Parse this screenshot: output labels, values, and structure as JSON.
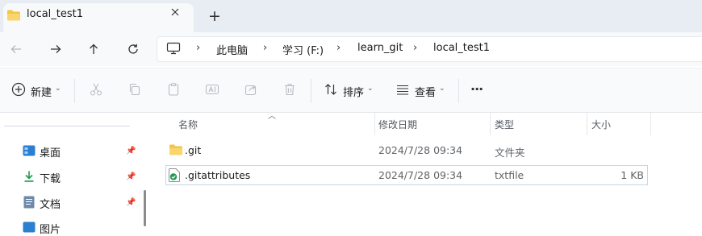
{
  "window": {
    "tab_title": "local_test1",
    "new_tab_label": "+"
  },
  "address": {
    "crumbs": [
      "此电脑",
      "学习 (F:)",
      "learn_git",
      "local_test1"
    ]
  },
  "toolbar": {
    "new_label": "新建",
    "sort_label": "排序",
    "view_label": "查看",
    "more_label": "···"
  },
  "sidebar": {
    "items": [
      {
        "label": "桌面",
        "icon": "desktop-icon",
        "pinned": true
      },
      {
        "label": "下载",
        "icon": "download-icon",
        "pinned": true
      },
      {
        "label": "文档",
        "icon": "document-icon",
        "pinned": true
      },
      {
        "label": "图片",
        "icon": "pictures-icon",
        "pinned": false
      }
    ]
  },
  "list": {
    "columns": [
      "名称",
      "修改日期",
      "类型",
      "大小"
    ],
    "rows": [
      {
        "name": ".git",
        "modified": "2024/7/28 09:34",
        "type": "文件夹",
        "size": "",
        "icon": "folder-icon"
      },
      {
        "name": ".gitattributes",
        "modified": "2024/7/28 09:34",
        "type": "txtfile",
        "size": "1 KB",
        "icon": "text-file-icon"
      }
    ]
  },
  "colors": {
    "accent": "#0067c0",
    "folder": "#f4c445",
    "tabbar_bg": "#e7edf3",
    "selection_border": "#c5d6e6"
  }
}
